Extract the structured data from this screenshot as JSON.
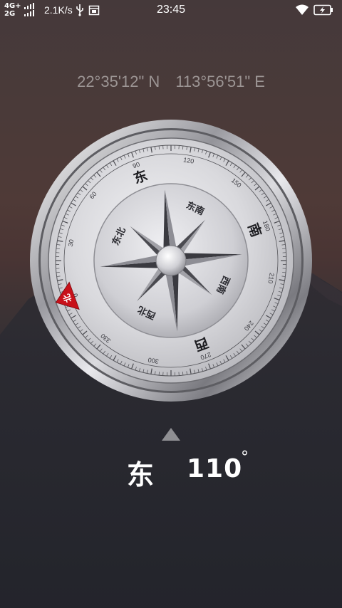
{
  "status_bar": {
    "network_top": "4G+",
    "network_bottom": "2G",
    "speed": "2.1K/s",
    "time": "23:45"
  },
  "location": {
    "latitude": "22°35'12\" N",
    "longitude": "113°56'51\" E"
  },
  "compass": {
    "heading_deg": 110,
    "heading_direction": "东",
    "heading_value": "110",
    "degree_symbol": "°",
    "north_label": "北",
    "cardinals": {
      "east": "东",
      "south": "南",
      "west": "西"
    },
    "intercardinals": {
      "northeast": "东北",
      "southeast": "东南",
      "southwest": "西南",
      "northwest": "西北"
    },
    "degree_labels": [
      "0",
      "30",
      "60",
      "90",
      "120",
      "150",
      "180",
      "210",
      "240",
      "270",
      "300",
      "330"
    ],
    "north_marker_color": "#c8111a"
  }
}
